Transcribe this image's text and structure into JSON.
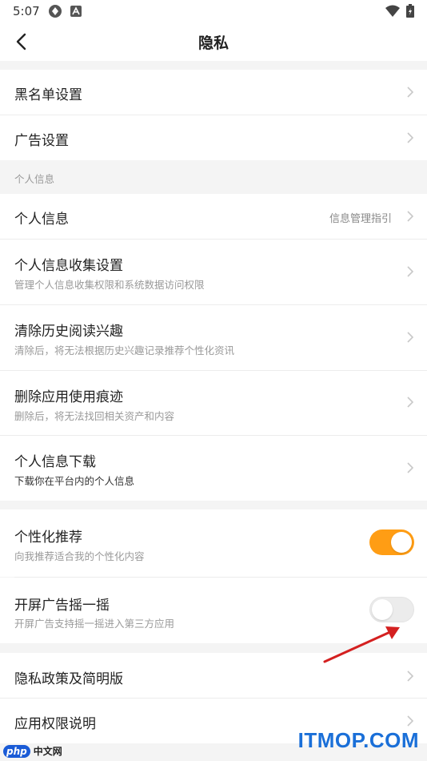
{
  "status_bar": {
    "time": "5:07"
  },
  "header": {
    "title": "隐私"
  },
  "group1": [
    {
      "label": "黑名单设置"
    },
    {
      "label": "广告设置"
    }
  ],
  "section_personal": {
    "title": "个人信息"
  },
  "personal": [
    {
      "label": "个人信息",
      "hint": "信息管理指引"
    },
    {
      "label": "个人信息收集设置",
      "sub": "管理个人信息收集权限和系统数据访问权限"
    },
    {
      "label": "清除历史阅读兴趣",
      "sub": "清除后，将无法根据历史兴趣记录推荐个性化资讯"
    },
    {
      "label": "删除应用使用痕迹",
      "sub": "删除后，将无法找回相关资产和内容"
    },
    {
      "label": "个人信息下载",
      "sub": "下载你在平台内的个人信息"
    }
  ],
  "toggles": [
    {
      "label": "个性化推荐",
      "sub": "向我推荐适合我的个性化内容",
      "state": "on"
    },
    {
      "label": "开屏广告摇一摇",
      "sub": "开屏广告支持摇一摇进入第三方应用",
      "state": "off"
    }
  ],
  "group3": [
    {
      "label": "隐私政策及简明版"
    },
    {
      "label": "应用权限说明"
    }
  ],
  "colors": {
    "accent": "#ff9d14",
    "arrow": "#d42020"
  },
  "watermark": {
    "left_badge": "php",
    "left_text": "中文网",
    "right_text": "ITMOP.COM"
  }
}
